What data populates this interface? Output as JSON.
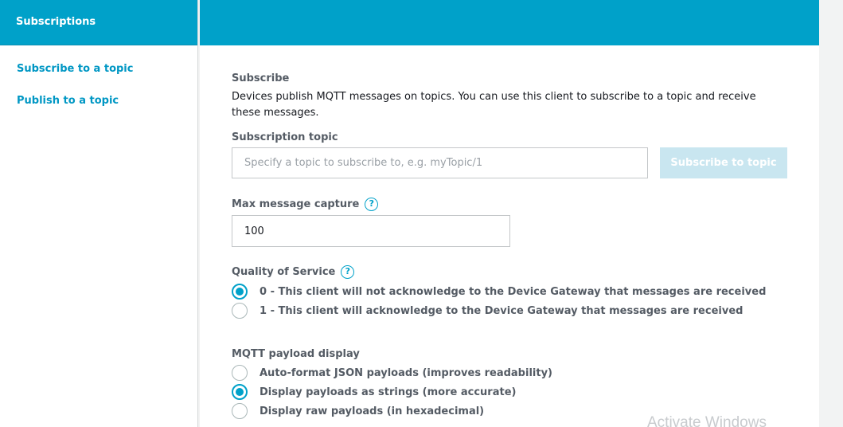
{
  "sidebar": {
    "header": "Subscriptions",
    "links": [
      {
        "label": "Subscribe to a topic"
      },
      {
        "label": "Publish to a topic"
      }
    ]
  },
  "subscribe": {
    "title": "Subscribe",
    "description": "Devices publish MQTT messages on topics. You can use this client to subscribe to a topic and receive these messages.",
    "topic_label": "Subscription topic",
    "topic_placeholder": "Specify a topic to subscribe to, e.g. myTopic/1",
    "topic_value": "",
    "subscribe_button": "Subscribe to topic",
    "max_capture_label": "Max message capture",
    "max_capture_value": "100",
    "help_glyph": "?",
    "qos_label": "Quality of Service",
    "qos_options": [
      {
        "label": "0 - This client will not acknowledge to the Device Gateway that messages are received",
        "checked": true
      },
      {
        "label": "1 - This client will acknowledge to the Device Gateway that messages are received",
        "checked": false
      }
    ],
    "payload_label": "MQTT payload display",
    "payload_options": [
      {
        "label": "Auto-format JSON payloads (improves readability)",
        "checked": false
      },
      {
        "label": "Display payloads as strings (more accurate)",
        "checked": true
      },
      {
        "label": "Display raw payloads (in hexadecimal)",
        "checked": false
      }
    ]
  },
  "watermark": "Activate Windows",
  "colors": {
    "accent": "#00a1c9",
    "link": "#0097c4",
    "disabled_button": "#c9e6f0"
  },
  "icons": {
    "help": "question-circle-icon",
    "radio_checked": "radio-checked-icon",
    "radio_unchecked": "radio-unchecked-icon"
  }
}
